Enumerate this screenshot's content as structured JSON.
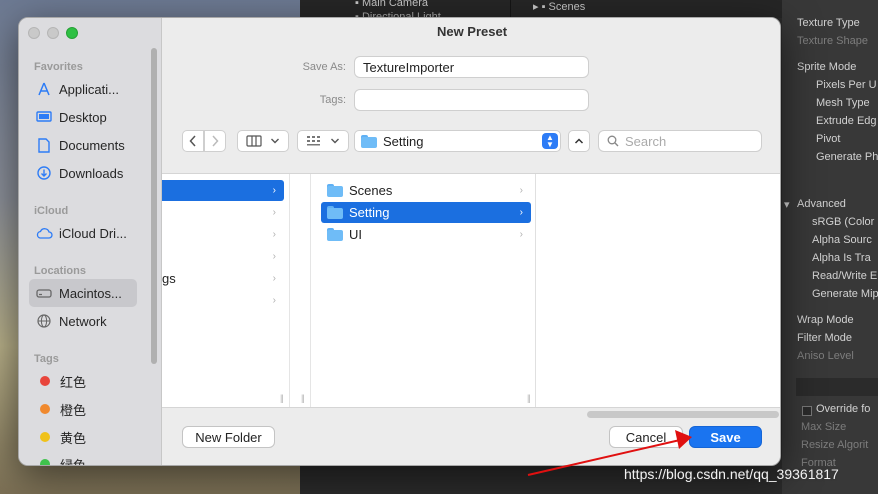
{
  "background": {
    "hierarchy": [
      "Main Camera",
      "Directional Light"
    ],
    "project": [
      "Scenes"
    ],
    "inspector": {
      "rows": [
        {
          "text": "Texture Type",
          "dim": false
        },
        {
          "text": "Texture Shape",
          "dim": true
        },
        {
          "text": "Sprite Mode",
          "dim": false
        },
        {
          "text": "Pixels Per U",
          "dim": false
        },
        {
          "text": "Mesh Type",
          "dim": false
        },
        {
          "text": "Extrude Edg",
          "dim": false
        },
        {
          "text": "Pivot",
          "dim": false
        },
        {
          "text": "Generate Ph",
          "dim": false
        },
        {
          "text": "Advanced",
          "dim": false
        },
        {
          "text": "sRGB (Color",
          "dim": false
        },
        {
          "text": "Alpha Sourc",
          "dim": false
        },
        {
          "text": "Alpha Is Tra",
          "dim": false
        },
        {
          "text": "Read/Write E",
          "dim": false
        },
        {
          "text": "Generate Mip",
          "dim": false
        },
        {
          "text": "Wrap Mode",
          "dim": false
        },
        {
          "text": "Filter Mode",
          "dim": false
        },
        {
          "text": "Aniso Level",
          "dim": true
        },
        {
          "text": "Override fo",
          "dim": false
        },
        {
          "text": "Max Size",
          "dim": true
        },
        {
          "text": "Resize Algorit",
          "dim": true
        },
        {
          "text": "Format",
          "dim": true
        }
      ]
    }
  },
  "dialog": {
    "title": "New Preset",
    "save_as_label": "Save As:",
    "save_as_value": "TextureImporter",
    "tags_label": "Tags:",
    "tags_value": "",
    "location": "Setting",
    "search_placeholder": "Search",
    "sidebar": {
      "favorites_header": "Favorites",
      "favorites": [
        {
          "label": "Applicati...",
          "icon": "applications-icon"
        },
        {
          "label": "Desktop",
          "icon": "desktop-icon"
        },
        {
          "label": "Documents",
          "icon": "documents-icon"
        },
        {
          "label": "Downloads",
          "icon": "downloads-icon"
        }
      ],
      "icloud_header": "iCloud",
      "icloud": [
        {
          "label": "iCloud Dri...",
          "icon": "icloud-icon"
        }
      ],
      "locations_header": "Locations",
      "locations": [
        {
          "label": "Macintos...",
          "icon": "harddisk-icon"
        },
        {
          "label": "Network",
          "icon": "network-icon"
        }
      ],
      "tags_header": "Tags",
      "tags": [
        {
          "label": "红色",
          "color": "#e8453c"
        },
        {
          "label": "橙色",
          "color": "#f0892e"
        },
        {
          "label": "黄色",
          "color": "#f0c21a"
        },
        {
          "label": "绿色",
          "color": "#3fc24c"
        }
      ]
    },
    "columns": {
      "first_partial": [
        "gs"
      ],
      "second": [
        "Scenes",
        "Setting",
        "UI"
      ]
    },
    "new_folder_label": "New Folder",
    "cancel_label": "Cancel",
    "save_label": "Save"
  },
  "watermark": "https://blog.csdn.net/qq_39361817",
  "colors": {
    "accent": "#1a74f0",
    "selection": "#1b6fe0",
    "annotation_arrow": "#e01010"
  }
}
